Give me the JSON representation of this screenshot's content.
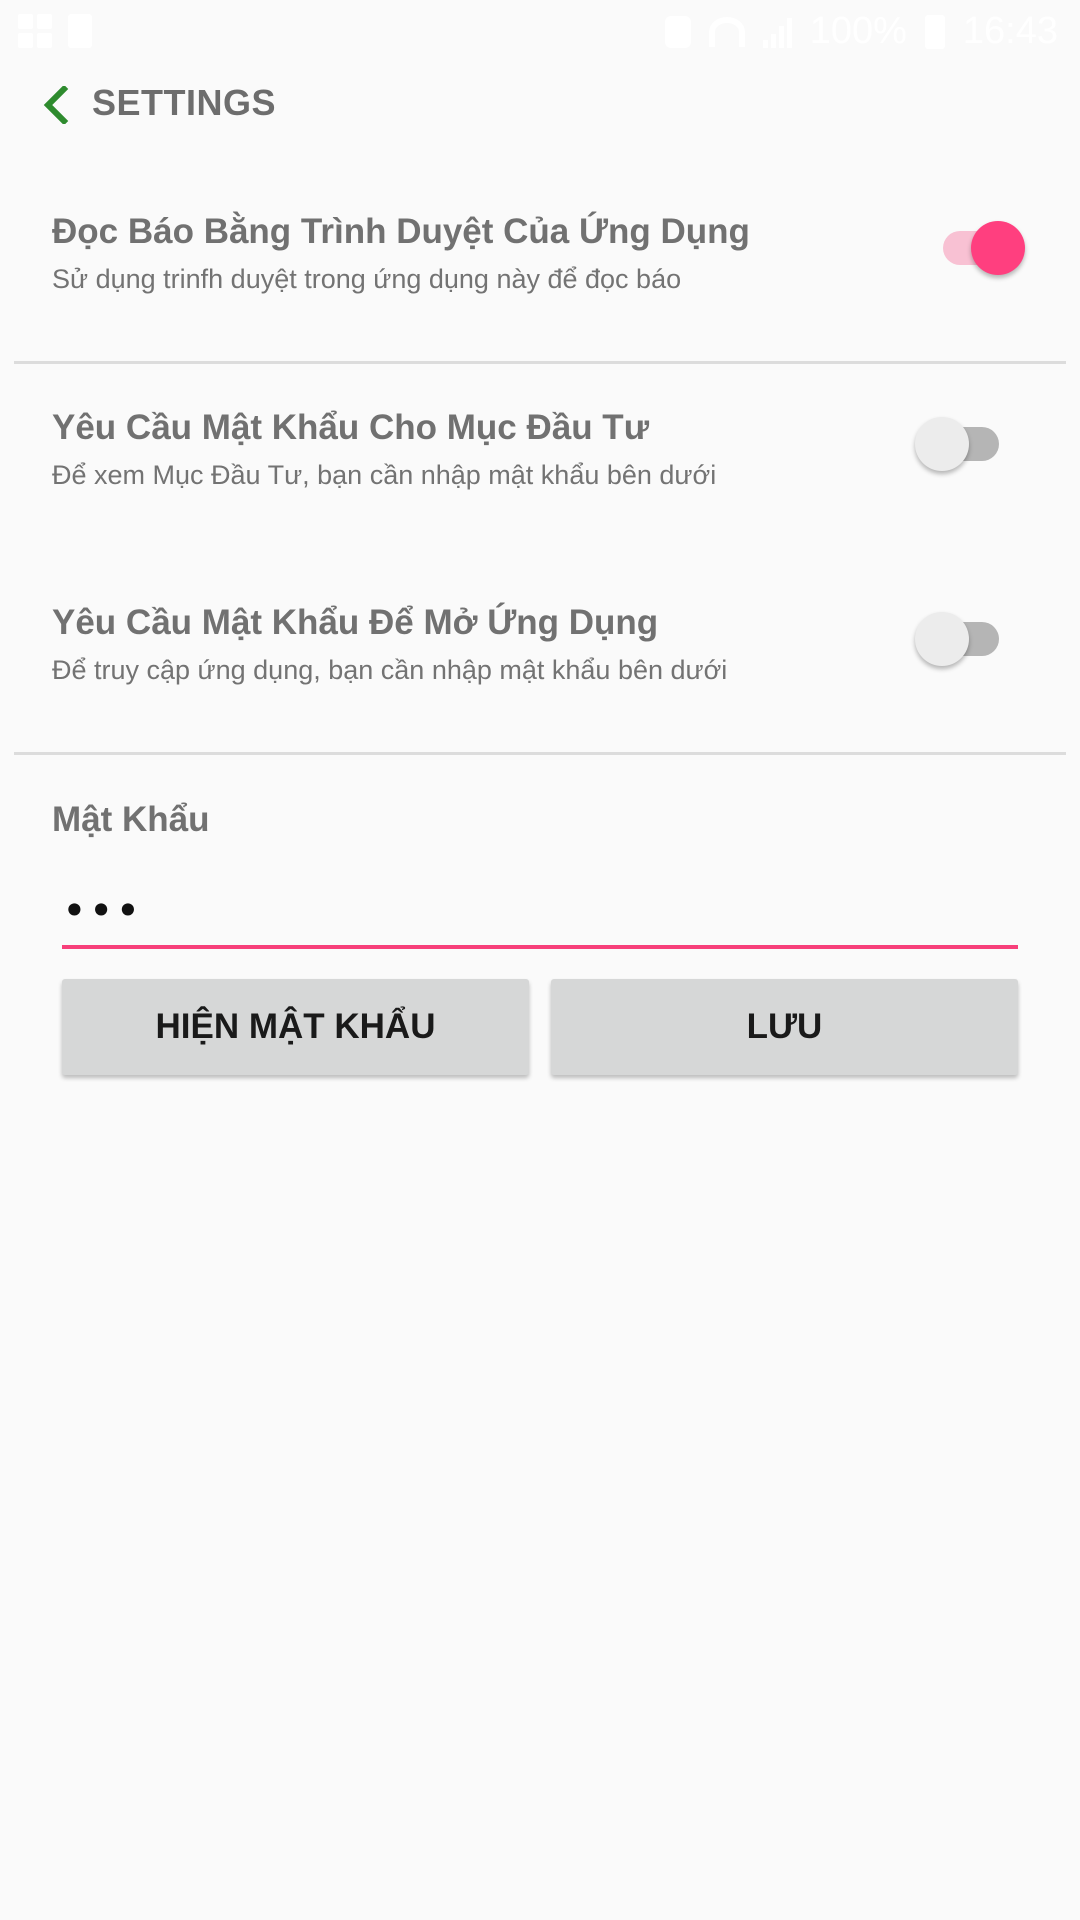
{
  "status_bar": {
    "battery": "100%",
    "time": "16:43"
  },
  "header": {
    "title": "SETTINGS",
    "back_icon": "chevron-left-icon",
    "accent_color": "#2e8b2e"
  },
  "settings": [
    {
      "title": "Đọc Báo Bằng Trình Duyệt Của Ứng Dụng",
      "description": "Sử dụng trinfh duyệt trong ứng dụng này để đọc báo",
      "enabled": true
    },
    {
      "title": "Yêu Cầu Mật Khẩu Cho Mục Đầu Tư",
      "description": "Để xem Mục Đầu Tư, bạn cần nhập mật khẩu bên dưới",
      "enabled": false
    },
    {
      "title": "Yêu Cầu Mật Khẩu Để Mở Ứng Dụng",
      "description": "Để truy cập ứng dụng, bạn cần nhập mật khẩu bên dưới",
      "enabled": false
    }
  ],
  "password": {
    "label": "Mật Khẩu",
    "value": "•••",
    "underline_color": "#f73f7a"
  },
  "buttons": {
    "show_password": "HIỆN MẬT KHẨU",
    "save": "LƯU"
  },
  "colors": {
    "switch_on_thumb": "#ff3f7f",
    "switch_on_track": "#f8c1d3",
    "switch_off_thumb": "#ececec",
    "switch_off_track": "#b5b5b5"
  }
}
